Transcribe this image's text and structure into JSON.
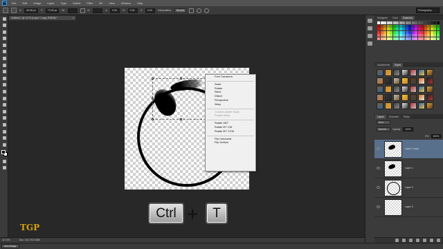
{
  "menubar": {
    "logo": "Ps",
    "items": [
      "File",
      "Edit",
      "Image",
      "Layer",
      "Type",
      "Select",
      "Filter",
      "3D",
      "View",
      "Window",
      "Help"
    ]
  },
  "options": {
    "x_value": "60.08 px",
    "y_value": "72.00 px",
    "w_value": "",
    "h_value": "",
    "angle_value": "0.00",
    "h_skew": "0.00",
    "v_skew": "0.00",
    "interpolation_label": "Interpolation:",
    "interpolation_value": "Bicubic",
    "workspace": "Photography"
  },
  "document": {
    "tab_title": "Untitled-1 @ 117% (Layer 1 copy, RGB/8) *",
    "close": "×"
  },
  "context_menu": {
    "groups": [
      [
        {
          "label": "Free Transform",
          "disabled": false
        }
      ],
      [
        {
          "label": "Scale",
          "disabled": false
        },
        {
          "label": "Rotate",
          "disabled": false
        },
        {
          "label": "Skew",
          "disabled": false
        },
        {
          "label": "Distort",
          "disabled": false
        },
        {
          "label": "Perspective",
          "disabled": false
        },
        {
          "label": "Warp",
          "disabled": false
        }
      ],
      [
        {
          "label": "Content-Aware Scale",
          "disabled": true
        },
        {
          "label": "Puppet Warp",
          "disabled": true
        }
      ],
      [
        {
          "label": "Rotate 180°",
          "disabled": false
        },
        {
          "label": "Rotate 90° CW",
          "disabled": false
        },
        {
          "label": "Rotate 90° CCW",
          "disabled": false
        }
      ],
      [
        {
          "label": "Flip Horizontal",
          "disabled": false
        },
        {
          "label": "Flip Vertical",
          "disabled": false
        }
      ]
    ]
  },
  "shortcut": {
    "key1": "Ctrl",
    "plus": "+",
    "key2": "T"
  },
  "logo": {
    "text": "TGP"
  },
  "status": {
    "zoom": "117.4%",
    "doc": "Doc: 161.7K/2.63M"
  },
  "bottom": {
    "mini_bridge": "Mini Bridge"
  },
  "panels": {
    "top_tabs": [
      "Histogram",
      "Color",
      "Swatches"
    ],
    "mid_tabs": [
      "Adjustments",
      "Styles"
    ],
    "layer_tabs": [
      "Layers",
      "Channels",
      "Paths"
    ],
    "blend_mode": "Normal",
    "opacity_label": "Opacity:",
    "opacity_value": "100%",
    "fill_label": "Fill:",
    "fill_value": "100%",
    "kind": "Kind",
    "layers": [
      {
        "name": "Layer 1 copy",
        "selected": true,
        "thumb": "stroke"
      },
      {
        "name": "Layer 1",
        "selected": false,
        "thumb": "stroke"
      },
      {
        "name": "Layer 2",
        "selected": false,
        "thumb": "ring"
      },
      {
        "name": "Layer 3",
        "selected": false,
        "thumb": "empty"
      }
    ]
  },
  "colors": {
    "accent": "#31a8ff",
    "selected_layer": "#59708c",
    "logo_gold": "#d7a20c"
  }
}
